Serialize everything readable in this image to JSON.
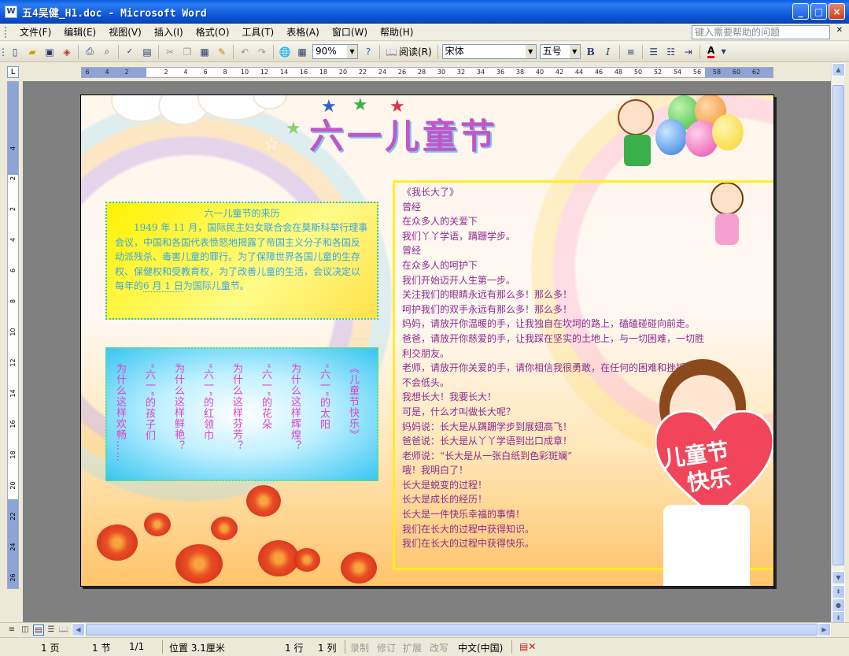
{
  "window": {
    "title": "五4吴健_H1.doc - Microsoft Word",
    "app_icon": "W",
    "buttons": [
      "_",
      "□",
      "×"
    ]
  },
  "menu": {
    "items": [
      "文件(F)",
      "编辑(E)",
      "视图(V)",
      "插入(I)",
      "格式(O)",
      "工具(T)",
      "表格(A)",
      "窗口(W)",
      "帮助(H)"
    ],
    "help_placeholder": "键入需要帮助的问题"
  },
  "toolbar": {
    "zoom": "90%",
    "read_label": "阅读(R)",
    "font_name": "宋体",
    "font_size": "五号",
    "bold": "B",
    "italic": "I",
    "font_color": "A",
    "font_color_hex": "#E00000"
  },
  "ruler": {
    "ticks": [
      "6",
      "4",
      "2",
      "2",
      "4",
      "6",
      "8",
      "10",
      "12",
      "14",
      "16",
      "18",
      "20",
      "22",
      "24",
      "26",
      "28",
      "30",
      "32",
      "34",
      "36",
      "38",
      "40",
      "42",
      "44",
      "46",
      "48",
      "50",
      "52",
      "54",
      "56",
      "58",
      "60",
      "62"
    ],
    "v_ticks": [
      "4",
      "2",
      "2",
      "4",
      "6",
      "8",
      "10",
      "12",
      "14",
      "16",
      "18",
      "20",
      "22",
      "24",
      "26"
    ]
  },
  "document": {
    "title": "六一儿童节",
    "origin_box": {
      "title": "六一儿童节的来历",
      "body_1": "1949 年 11 月，国际民主妇女联合会在莫斯科举行理事会议，中国和各国代表愤怒地揭露了帝国主义分子和各国反动派残杀、毒害儿童的罪行。为了保障世界各国儿童的生存权、保健权和受教育权，为了改善儿童的生活，会议决定以每年的",
      "date": "6 月 1 日",
      "body_2": "为国际儿童节。"
    },
    "poem_columns": [
      "《儿童节快乐》",
      "“六一”的太阳",
      "为什么这样辉煌？",
      "“六一”的花朵",
      "为什么这样芬芳？",
      "“六一”的红领巾",
      "为什么这样鲜艳？",
      "“六一”的孩子们",
      "为什么这样欢畅……"
    ],
    "grow_lines": [
      "《我长大了》",
      "曾经",
      "在众多人的关爱下",
      "我们丫丫学语，蹒跚学步。",
      "曾经",
      "在众多人的呵护下",
      "我们开始迈开人生第一步。",
      "关注我们的眼睛永远有那么多！那么多！",
      "呵护我们的双手永远有那么多！那么多！",
      "妈妈，请放开你温暖的手，让我独自在坎坷的路上，磕磕碰碰向前走。",
      "爸爸，请放开你慈爱的手，让我踩在坚实的土地上，与一切困难，一切胜",
      "利交朋友。",
      "老师，请放开你关爱的手，请你相信我很勇敢，在任何的困难和挫折面前",
      "不会低头。",
      "我想长大！我要长大！",
      "可是，什么才叫做长大呢？",
      "妈妈说：长大是从蹒跚学步到展翅高飞！",
      "爸爸说：长大是从丫丫学语到出口成章！",
      "老师说：“长大是从一张白纸到色彩斑斓”",
      "哦！我明白了！",
      "长大是蜕变的过程！",
      "长大是成长的经历！",
      "长大是一件快乐幸福的事情！",
      "我们在长大的过程中获得知识。",
      "我们在长大的过程中获得快乐。"
    ],
    "heart_text_1": "儿童节",
    "heart_text_2": "快乐"
  },
  "status": {
    "page": "1 页",
    "section": "1 节",
    "page_of": "1/1",
    "position": "位置 3.1厘米",
    "line": "1 行",
    "col": "1 列",
    "rec": "录制",
    "trk": "修订",
    "ext": "扩展",
    "ovr": "改写",
    "lang": "中文(中国)"
  }
}
